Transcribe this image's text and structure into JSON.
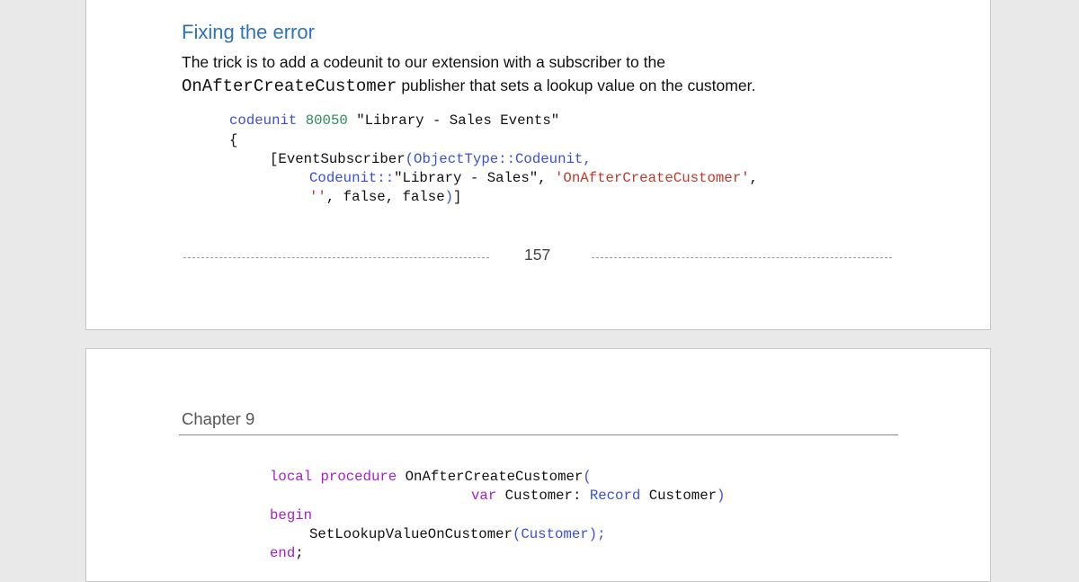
{
  "page1": {
    "heading": "Fixing the error",
    "para_line1": "The trick is to add a codeunit to our extension with a subscriber to the",
    "para_code": "OnAfterCreateCustomer",
    "para_line2_rest": " publisher that sets a lookup value on the customer.",
    "code": {
      "l1_kw": "codeunit",
      "l1_num": "80050",
      "l1_name": " \"Library - Sales Events\"",
      "l2": "{",
      "l3_open": "[EventSubscriber",
      "l3_paren": "(ObjectType::Codeunit,",
      "l4_codeunit": "Codeunit::",
      "l4_name": "\"Library - Sales\", ",
      "l4_str": "'OnAfterCreateCustomer'",
      "l4_comma": ",",
      "l5_str": "''",
      "l5_rest": ", false, false",
      "l5_paren": ")",
      "l5_bracket": "]"
    },
    "page_number": "157"
  },
  "page2": {
    "chapter": "Chapter 9",
    "code": {
      "l1_kw1": "local",
      "l1_kw2": "procedure",
      "l1_name": " OnAfterCreateCustomer",
      "l1_paren": "(",
      "l2_var": "var",
      "l2_mid": " Customer: ",
      "l2_record": "Record",
      "l2_type": " Customer",
      "l2_paren": ")",
      "l3_begin": "begin",
      "l4_call": "SetLookupValueOnCustomer",
      "l4_args": "(Customer);",
      "l5_end": "end",
      "l5_semi": ";"
    }
  },
  "colors": {
    "heading": "#2e74b5",
    "keyword": "#3b4fd6",
    "number": "#2e8b57",
    "string": "#c0392b",
    "purple_keyword": "#a520c8"
  }
}
